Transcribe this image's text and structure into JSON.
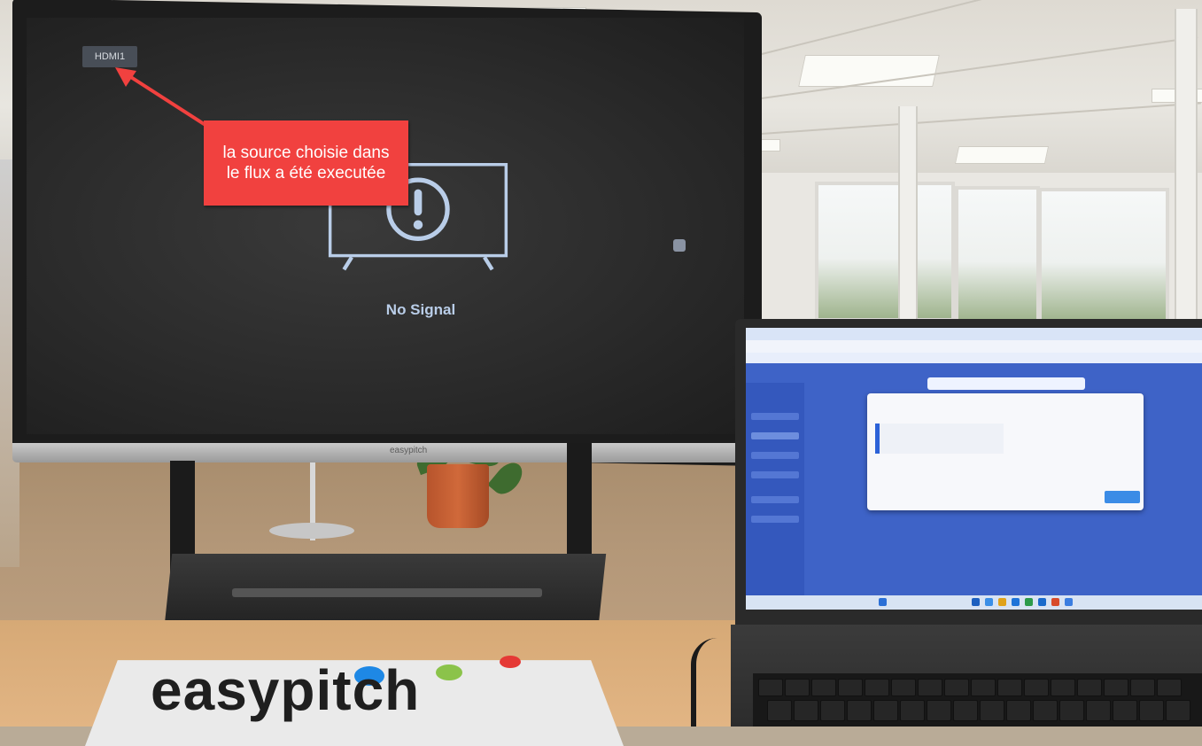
{
  "tv": {
    "source_badge": "HDMI1",
    "status_text": "No Signal",
    "brand": "easypitch"
  },
  "annotation": {
    "callout_text_line1": "la source choisie dans",
    "callout_text_line2": "le flux a été executée",
    "color": "#f1413f"
  },
  "product_box": {
    "logo_text": "easypitch",
    "dot_colors": [
      "#1e88e5",
      "#8bc34a",
      "#e53935"
    ]
  },
  "icons": {
    "no_signal": "tv-warning-icon",
    "arrow": "arrow-icon"
  }
}
